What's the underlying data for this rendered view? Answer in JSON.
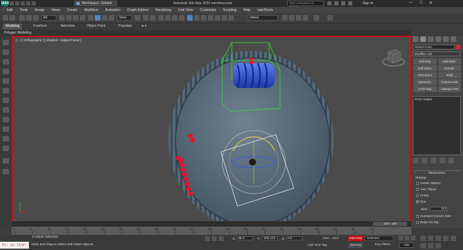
{
  "titlebar": {
    "logo": "MAX",
    "workspace": "Workspace: Default",
    "title": "Autodesk 3ds Max 2016    wormkey.max",
    "search_placeholder": "Type a keyword or phrase",
    "signin": "Sign In"
  },
  "menu": [
    "Edit",
    "Tools",
    "Group",
    "Views",
    "Create",
    "Modifiers",
    "Animation",
    "Graph Editors",
    "Rendering",
    "Civil View",
    "Customize",
    "Scripting",
    "Help",
    "rapidTools"
  ],
  "toolbar": {
    "selection_filter": "All",
    "ref_coord": "View",
    "named_selection": "wheel"
  },
  "ribbon": {
    "tabs": [
      "Modeling",
      "Freeform",
      "Selection",
      "Object Paint",
      "Populate"
    ],
    "active_tab": "Modeling",
    "sub_label": "Polygon Modeling"
  },
  "viewport": {
    "label": "[ + ] [ Orthographic ] [ Shaded + Edged Faces ]"
  },
  "command_panel": {
    "object_name": "Wheel Point",
    "modifier_list": "Modifier List",
    "modifier_buttons": [
      "Edit Poly",
      "Edit Mesh",
      "Edit Spline",
      "Extrude",
      "FFD 4x4x4",
      "Shell",
      "Symmetry",
      "TurboSmooth",
      "UVW Map",
      "Unwrap UVW"
    ],
    "stack_item": "Point Helper",
    "rollout_title": "Parameters",
    "display_label": "Display:",
    "checkboxes": [
      {
        "label": "Center Marker",
        "checked": false
      },
      {
        "label": "Axis Tripod",
        "checked": false
      },
      {
        "label": "Cross",
        "checked": false
      },
      {
        "label": "Box",
        "checked": true
      }
    ],
    "size_label": "Size:",
    "size_value": "32.0",
    "checkboxes2": [
      {
        "label": "Constant Screen Size",
        "checked": false
      },
      {
        "label": "Draw On Top",
        "checked": false
      }
    ]
  },
  "timeline": {
    "slider_label": "100 / 100",
    "ticks": [
      "0",
      "5",
      "10",
      "15",
      "20",
      "25",
      "30",
      "35",
      "40",
      "45",
      "50",
      "55",
      "60",
      "65",
      "70",
      "75",
      "80",
      "85",
      "90",
      "95",
      "100"
    ]
  },
  "status": {
    "maxscript": "Pt: in line:",
    "selection": "1 Helper Selected",
    "prompt": "Click and drag to select and rotate objects",
    "x_label": "X:",
    "x_value": "86.0",
    "y_label": "Y:",
    "y_value": "-205.213",
    "z_label": "Z:",
    "z_value": "0.0",
    "grid": "Grid = 10.0",
    "add_time_tag": "Add Time Tag",
    "auto_key": "Auto Key",
    "set_key": "Set Key",
    "key_selected": "Selected",
    "key_filters": "Key Filters...",
    "frame": "100"
  },
  "colors": {
    "viewport_border": "#c2111a",
    "gear": "#4e5f6e",
    "worm": "#2a4fd0",
    "bounding_box": "#35e035",
    "markers": "#e4142a"
  }
}
